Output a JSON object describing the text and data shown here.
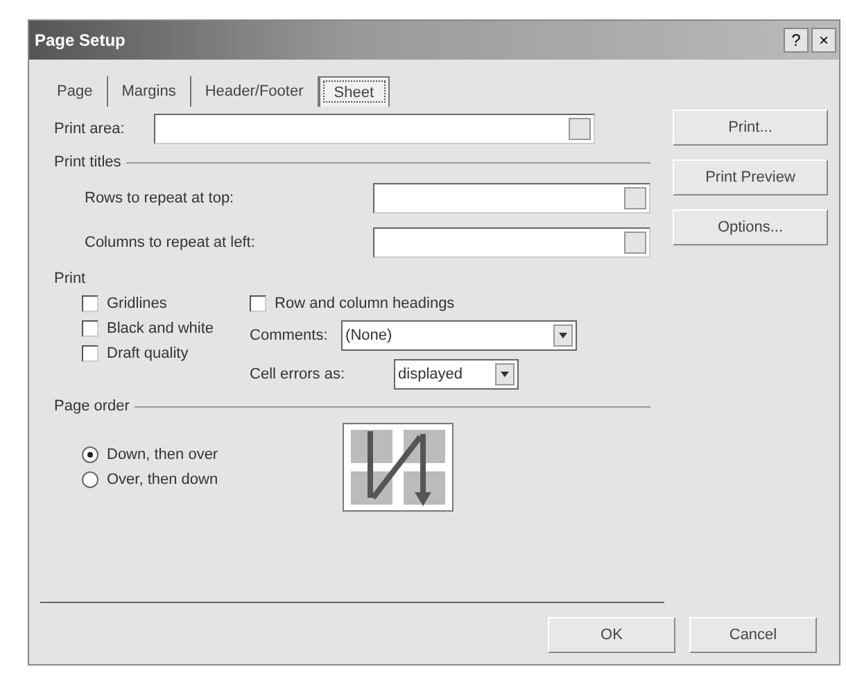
{
  "window": {
    "title": "Page Setup",
    "help": "?",
    "close": "×"
  },
  "tabs": [
    {
      "label": "Page",
      "selected": false
    },
    {
      "label": "Margins",
      "selected": false
    },
    {
      "label": "Header/Footer",
      "selected": false
    },
    {
      "label": "Sheet",
      "selected": true
    }
  ],
  "print_area": {
    "label": "Print area:"
  },
  "print_titles": {
    "heading": "Print titles",
    "fields": [
      {
        "label": "Rows to repeat at top:"
      },
      {
        "label": "Columns to repeat at left:"
      }
    ]
  },
  "side_buttons": [
    "Print...",
    "Print Preview",
    "Options..."
  ],
  "print": {
    "heading": "Print",
    "checkboxes": [
      {
        "label": "Gridlines",
        "checked": false
      },
      {
        "label": "Black and white",
        "checked": false
      },
      {
        "label": "Draft quality",
        "checked": false
      }
    ],
    "headings_checkbox": {
      "label": "Row and column headings",
      "checked": false
    },
    "comments": {
      "label": "Comments:",
      "value": "(None)"
    },
    "cell_errors": {
      "label": "Cell errors as:",
      "value": "displayed"
    }
  },
  "page_order": {
    "heading": "Page order",
    "options": [
      {
        "label": "Down, then over",
        "selected": true
      },
      {
        "label": "Over, then down",
        "selected": false
      }
    ]
  },
  "buttons": [
    "OK",
    "Cancel"
  ]
}
